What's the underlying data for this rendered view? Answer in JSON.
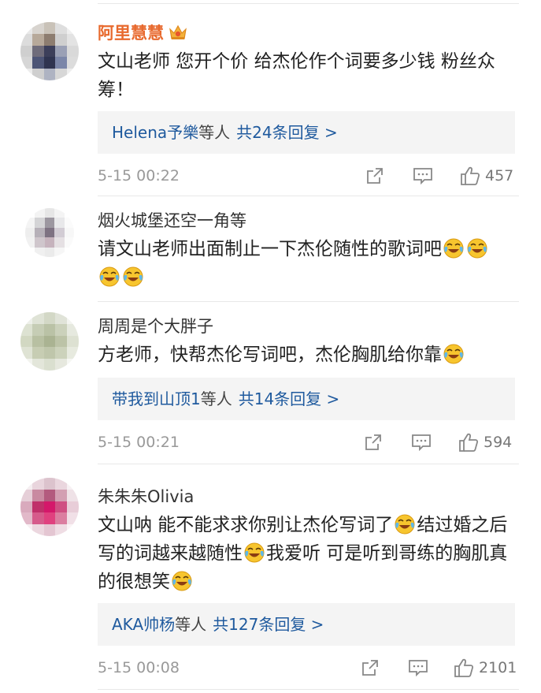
{
  "comments": [
    {
      "user": "阿里慧慧",
      "text": "文山老师 您开个价 给杰伦作个词要多少钱 粉丝众筹！",
      "reply_users": "Helena予樂",
      "reply_mid": "等人",
      "reply_count": "共24条回复 >",
      "time": "5-15 00:22",
      "likes": "457"
    },
    {
      "user": "烟火城堡还空一角等",
      "text": "请文山老师出面制止一下杰伦随性的歌词吧",
      "time": "",
      "likes": ""
    },
    {
      "user": "周周是个大胖子",
      "text": "方老师，快帮杰伦写词吧，杰伦胸肌给你靠",
      "reply_users": "带我到山顶1",
      "reply_mid": "等人",
      "reply_count": "共14条回复 >",
      "time": "5-15 00:21",
      "likes": "594"
    },
    {
      "user": "朱朱朱Olivia",
      "text_a": "文山呐 能不能求求你别让杰伦写词了",
      "text_b": "结过婚之后写的词越来越随性",
      "text_c": "我爱听 可是听到哥练的胸肌真的很想笑",
      "reply_users": "AKA帅杨",
      "reply_mid": "等人",
      "reply_count": "共127条回复 >",
      "time": "5-15 00:08",
      "likes": "2101"
    }
  ],
  "icons": {
    "vip": "crown-icon",
    "emoji": "laugh-cry-emoji",
    "share": "share-icon",
    "comment": "comment-icon",
    "like": "thumbs-up-icon"
  },
  "colors": {
    "vip_name": "#e86a2e",
    "link": "#1f5a9e",
    "meta": "#999999",
    "reply_bg": "#f4f4f4"
  }
}
